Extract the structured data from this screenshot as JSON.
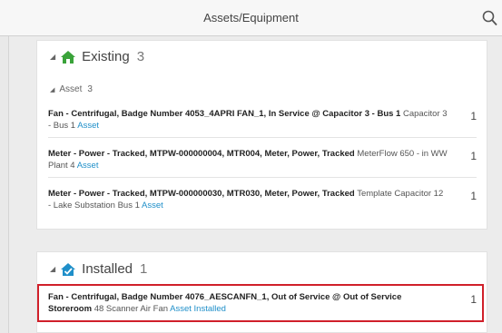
{
  "header": {
    "title": "Assets/Equipment",
    "search_icon": "search-icon"
  },
  "existing": {
    "label": "Existing",
    "count": "3",
    "icon": "house-icon",
    "icon_color": "#3aa33a",
    "asset_group": {
      "label": "Asset",
      "count": "3"
    },
    "items": [
      {
        "title": "Fan - Centrifugal, Badge Number 4053_4APRI FAN_1, In Service @ Capacitor 3 - Bus 1",
        "detail": "Capacitor 3 - Bus 1",
        "link": "Asset",
        "qty": "1"
      },
      {
        "title": "Meter - Power - Tracked, MTPW-000000004, MTR004, Meter, Power, Tracked",
        "detail": "MeterFlow 650 - in WW Plant 4",
        "link": "Asset",
        "qty": "1"
      },
      {
        "title": "Meter - Power - Tracked, MTPW-000000030, MTR030, Meter, Power, Tracked",
        "detail": "Template Capacitor 12 - Lake Substation Bus 1",
        "link": "Asset",
        "qty": "1"
      }
    ]
  },
  "installed": {
    "label": "Installed",
    "count": "1",
    "icon": "house-check-icon",
    "icon_color": "#1f8fc9",
    "items": [
      {
        "title": "Fan - Centrifugal, Badge Number 4076_AESCANFN_1, Out of Service @ Out of Service Storeroom",
        "detail": "48 Scanner Air Fan",
        "link": "Asset Installed",
        "qty": "1"
      }
    ]
  }
}
